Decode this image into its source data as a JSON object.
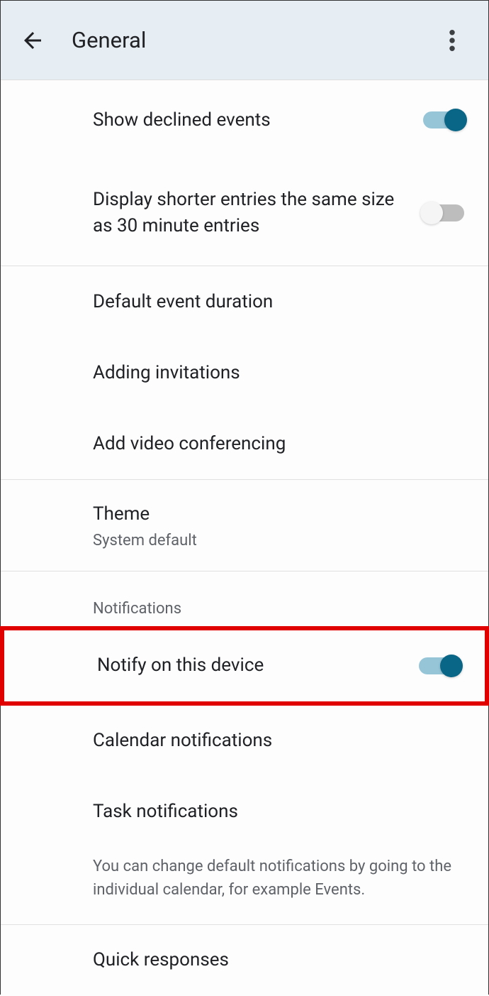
{
  "header": {
    "title": "General"
  },
  "settings": {
    "show_declined_events": {
      "label": "Show declined events",
      "enabled": true
    },
    "shorter_entries": {
      "label": "Display shorter entries the same size as 30 minute entries",
      "enabled": false
    },
    "default_event_duration": {
      "label": "Default event duration"
    },
    "adding_invitations": {
      "label": "Adding invitations"
    },
    "add_video_conferencing": {
      "label": "Add video conferencing"
    },
    "theme": {
      "label": "Theme",
      "value": "System default"
    },
    "notifications": {
      "section_label": "Notifications",
      "notify_on_device": {
        "label": "Notify on this device",
        "enabled": true
      },
      "calendar_notifications": {
        "label": "Calendar notifications"
      },
      "task_notifications": {
        "label": "Task notifications"
      },
      "footer": "You can change default notifications by going to the individual calendar, for example Events."
    },
    "quick_responses": {
      "label": "Quick responses"
    }
  }
}
